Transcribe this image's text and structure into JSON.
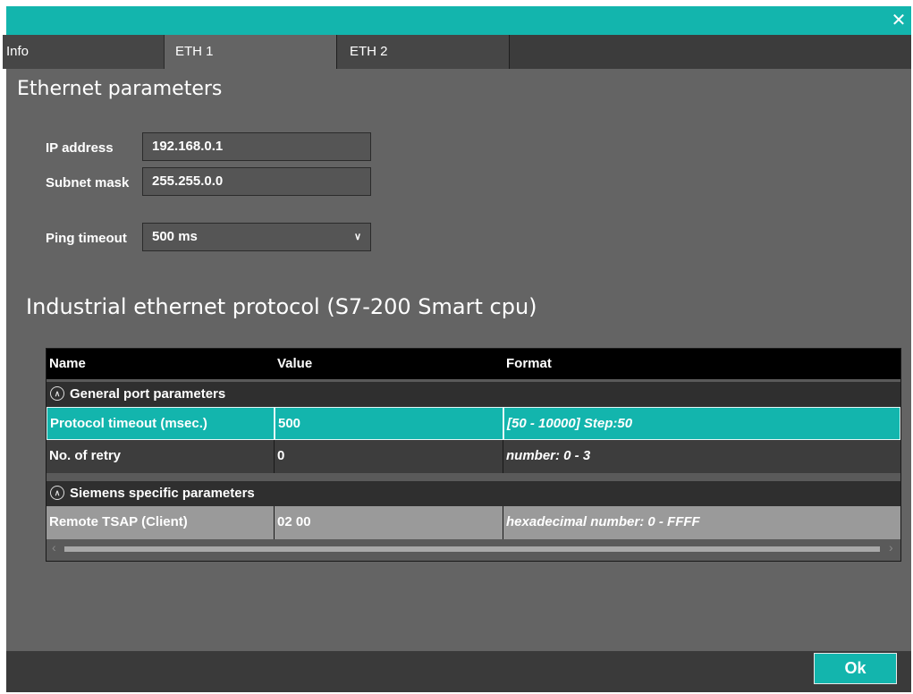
{
  "tabs": [
    {
      "label": "Info"
    },
    {
      "label": "ETH 1"
    },
    {
      "label": "ETH 2"
    }
  ],
  "ethernet": {
    "title": "Ethernet parameters",
    "ip_label": "IP address",
    "ip_value": "192.168.0.1",
    "subnet_label": "Subnet mask",
    "subnet_value": "255.255.0.0",
    "ping_label": "Ping timeout",
    "ping_value": "500 ms"
  },
  "protocol": {
    "title": "Industrial ethernet protocol (S7-200 Smart cpu)",
    "columns": [
      "Name",
      "Value",
      "Format"
    ],
    "groups": [
      {
        "label": "General port parameters",
        "rows": [
          {
            "name": "Protocol timeout (msec.)",
            "value": "500",
            "format": "[50 - 10000] Step:50"
          },
          {
            "name": "No. of retry",
            "value": "0",
            "format": "number: 0 - 3"
          }
        ]
      },
      {
        "label": "Siemens specific parameters",
        "rows": [
          {
            "name": "Remote TSAP (Client)",
            "value": "02 00",
            "format": "hexadecimal number: 0 - FFFF"
          }
        ]
      }
    ]
  },
  "footer": {
    "ok_label": "Ok"
  },
  "colors": {
    "accent": "#13b5ad",
    "window_bg": "#646464"
  },
  "icons": {
    "close": "close-icon",
    "dropdown": "chevron-down-icon",
    "collapse": "chevron-up-circle-icon"
  }
}
